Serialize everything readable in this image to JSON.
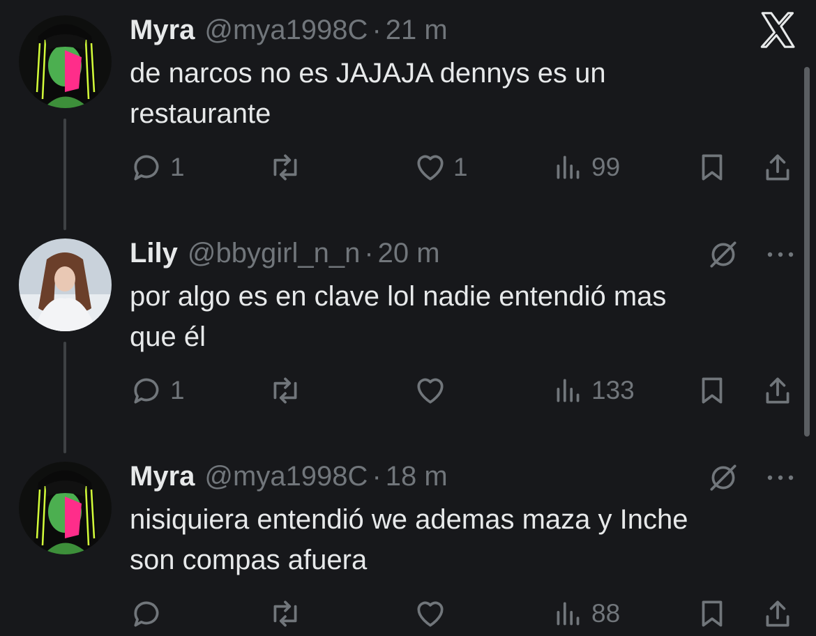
{
  "app": {
    "logo": "x-logo-icon"
  },
  "tweets": [
    {
      "name": "Myra",
      "handle": "@mya1998C",
      "separator": "·",
      "time": "21 m",
      "text_line1": "de narcos no es JAJAJA dennys es un",
      "text_line2": "restaurante",
      "replies": "1",
      "retweets": "",
      "likes": "1",
      "views": "99"
    },
    {
      "name": "Lily",
      "handle": "@bbygirl_n_n",
      "separator": "·",
      "time": "20 m",
      "text_line1": "por algo es en clave lol nadie entendió mas",
      "text_line2": "que él",
      "replies": "1",
      "retweets": "",
      "likes": "",
      "views": "133"
    },
    {
      "name": "Myra",
      "handle": "@mya1998C",
      "separator": "·",
      "time": "18 m",
      "text_line1": "nisiquiera entendió we ademas maza y Inche",
      "text_line2": "son compas afuera",
      "replies": "",
      "retweets": "",
      "likes": "",
      "views": "88"
    }
  ],
  "colors": {
    "background": "#17181b",
    "text": "#e7e9ea",
    "muted": "#71767b",
    "thread_line": "#3e4144"
  }
}
